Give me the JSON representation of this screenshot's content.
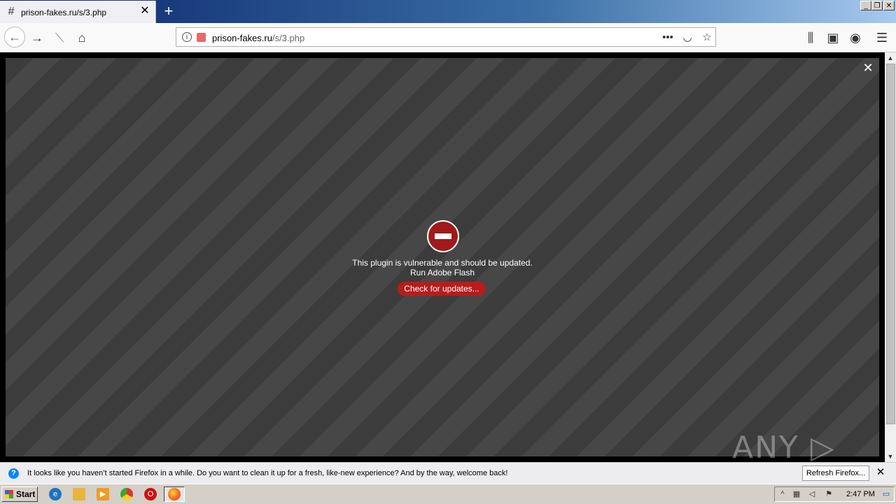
{
  "browser": {
    "tab_title": "prison-fakes.ru/s/3.php",
    "tab_close": "✕",
    "newtab_glyph": "+",
    "url_domain": "prison-fakes.ru",
    "url_path": "/s/3.php",
    "window_controls": [
      "_",
      "❐",
      "✕"
    ]
  },
  "plugin": {
    "message_line1": "This plugin is vulnerable and should be updated.",
    "message_line2": "Run Adobe Flash",
    "button_label": "Check for updates...",
    "close_glyph": "✕"
  },
  "watermark": "ANY ▷ RUN",
  "notification": {
    "text": "It looks like you haven’t started Firefox in a while. Do you want to clean it up for a fresh, like-new experience? And by the way, welcome back!",
    "button_label": "Refresh Firefox...",
    "close_glyph": "✕"
  },
  "taskbar": {
    "start_label": "Start",
    "clock": "2:47 PM"
  },
  "colors": {
    "accent_red": "#b81c1c",
    "notification_info": "#0a84ff"
  }
}
